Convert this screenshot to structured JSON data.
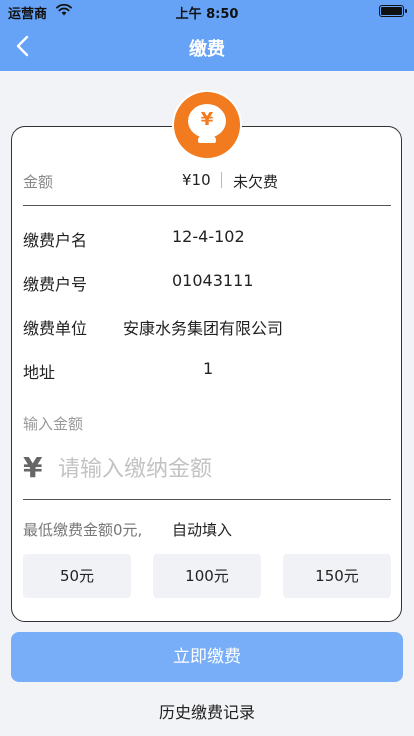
{
  "status_bar": {
    "carrier": "运营商",
    "time": "上午 8:50"
  },
  "nav": {
    "title": "缴费",
    "back_icon": "chevron-left-icon"
  },
  "badge": {
    "icon": "yen-coin-icon",
    "symbol": "¥",
    "color": "#f27a1f"
  },
  "summary": {
    "amount_label": "金额",
    "amount_value": "¥10",
    "arrears_status": "未欠费"
  },
  "details": [
    {
      "label": "缴费户名",
      "value": "12-4-102"
    },
    {
      "label": "缴费户号",
      "value": "01043111"
    },
    {
      "label": "缴费单位",
      "value": "安康水务集团有限公司"
    },
    {
      "label": "地址",
      "value": "1"
    }
  ],
  "input": {
    "label": "输入金额",
    "currency_symbol": "¥",
    "placeholder": "请输入缴纳金额",
    "value": ""
  },
  "min_hint": {
    "text": "最低缴费金额0元,",
    "autofill_label": "自动填入"
  },
  "quick_amounts": [
    "50元",
    "100元",
    "150元"
  ],
  "actions": {
    "pay_label": "立即缴费",
    "history_label": "历史缴费记录"
  },
  "colors": {
    "header": "#66a3f7",
    "pay_button": "#78aef7",
    "accent_orange": "#f27a1f"
  }
}
